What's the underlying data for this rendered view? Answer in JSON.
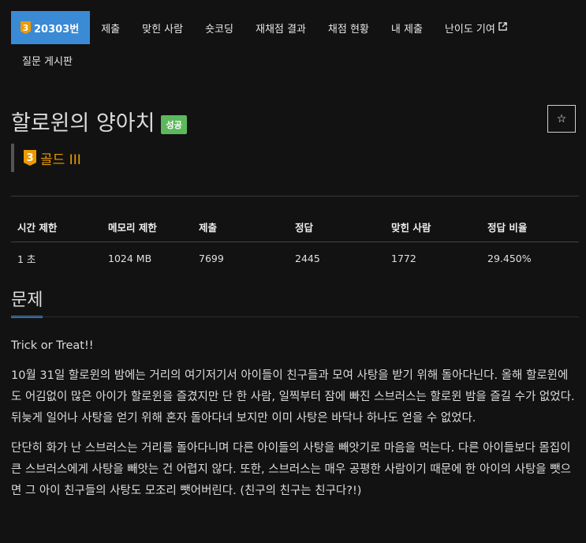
{
  "nav": {
    "problem_number": "20303번",
    "tier_digit": "3",
    "tabs": [
      "제출",
      "맞힌 사람",
      "숏코딩",
      "재채점 결과",
      "채점 현황",
      "내 제출",
      "난이도 기여"
    ],
    "board": "질문 게시판"
  },
  "problem": {
    "title": "할로윈의 양아치",
    "result": "성공",
    "tier_digit": "3",
    "tier_name": "골드 III",
    "star": "☆"
  },
  "stats": {
    "headers": [
      "시간 제한",
      "메모리 제한",
      "제출",
      "정답",
      "맞힌 사람",
      "정답 비율"
    ],
    "values": [
      "1 초",
      "1024 MB",
      "7699",
      "2445",
      "1772",
      "29.450%"
    ]
  },
  "section": {
    "title": "문제"
  },
  "description": [
    "Trick or Treat!!",
    "10월 31일 할로윈의 밤에는 거리의 여기저기서 아이들이 친구들과 모여 사탕을 받기 위해 돌아다닌다. 올해 할로윈에도 어김없이 많은 아이가 할로윈을 즐겼지만 단 한 사람, 일찍부터 잠에 빠진 스브러스는 할로윈 밤을 즐길 수가 없었다. 뒤늦게 일어나 사탕을 얻기 위해 혼자 돌아다녀 보지만 이미 사탕은 바닥나 하나도 얻을 수 없었다.",
    "단단히 화가 난 스브러스는 거리를 돌아다니며 다른 아이들의 사탕을 빼앗기로 마음을 먹는다. 다른 아이들보다 몸집이 큰 스브러스에게 사탕을 빼앗는 건 어렵지 않다. 또한, 스브러스는 매우 공평한 사람이기 때문에 한 아이의 사탕을 뺏으면 그 아이 친구들의 사탕도 모조리 뺏어버린다. (친구의 친구는 친구다?!)"
  ]
}
